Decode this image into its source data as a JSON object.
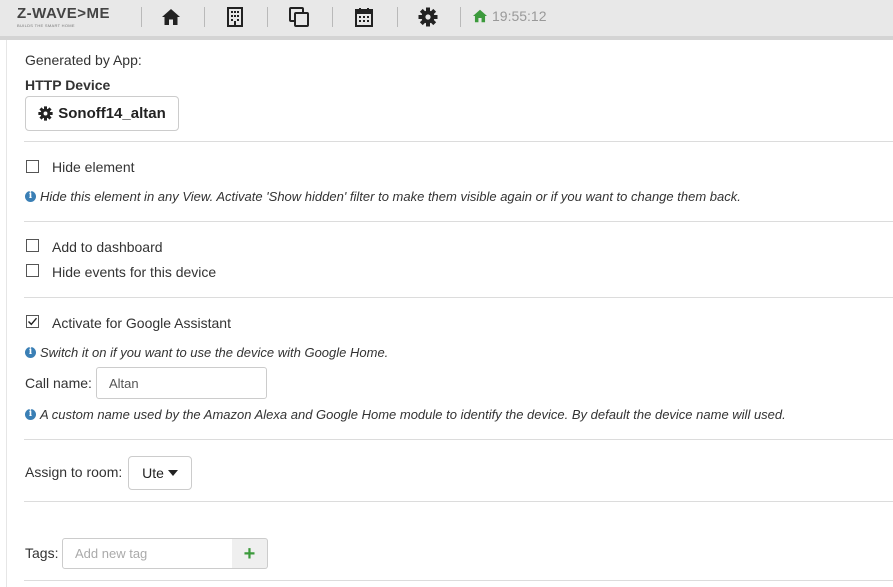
{
  "brand": {
    "logo_main": "Z-WAVE>ME",
    "logo_sub": "BUILDS THE SMART HOME"
  },
  "nav": {
    "icons": [
      "home-icon",
      "building-icon",
      "copy-icon",
      "calendar-icon",
      "gear-icon"
    ]
  },
  "clock": {
    "icon": "home-icon",
    "time": "19:55:12",
    "color": "#3c9a3c"
  },
  "app_section": {
    "generated_label": "Generated by App:",
    "app_name": "HTTP Device",
    "instance_button": "Sonoff14_altan",
    "instance_icon": "gear-icon"
  },
  "hide_element": {
    "label": "Hide element",
    "checked": false,
    "hint": "Hide this element in any View. Activate 'Show hidden' filter to make them visible again or if you want to change them back."
  },
  "dashboard": {
    "add_label": "Add to dashboard",
    "add_checked": false,
    "hide_events_label": "Hide events for this device",
    "hide_events_checked": false
  },
  "google": {
    "activate_label": "Activate for Google Assistant",
    "activate_checked": true,
    "hint": "Switch it on if you want to use the device with Google Home.",
    "call_name_label": "Call name:",
    "call_name_value": "Altan",
    "call_name_hint": "A custom name used by the Amazon Alexa and Google Home module to identify the device. By default the device name will used."
  },
  "room": {
    "label": "Assign to room:",
    "selected": "Ute"
  },
  "tags": {
    "label": "Tags:",
    "placeholder": "Add new tag",
    "add_symbol": "+",
    "add_color": "#3c9a3c"
  },
  "colors": {
    "info": "#3a7fb5",
    "topbar": "#e8e8e8"
  }
}
